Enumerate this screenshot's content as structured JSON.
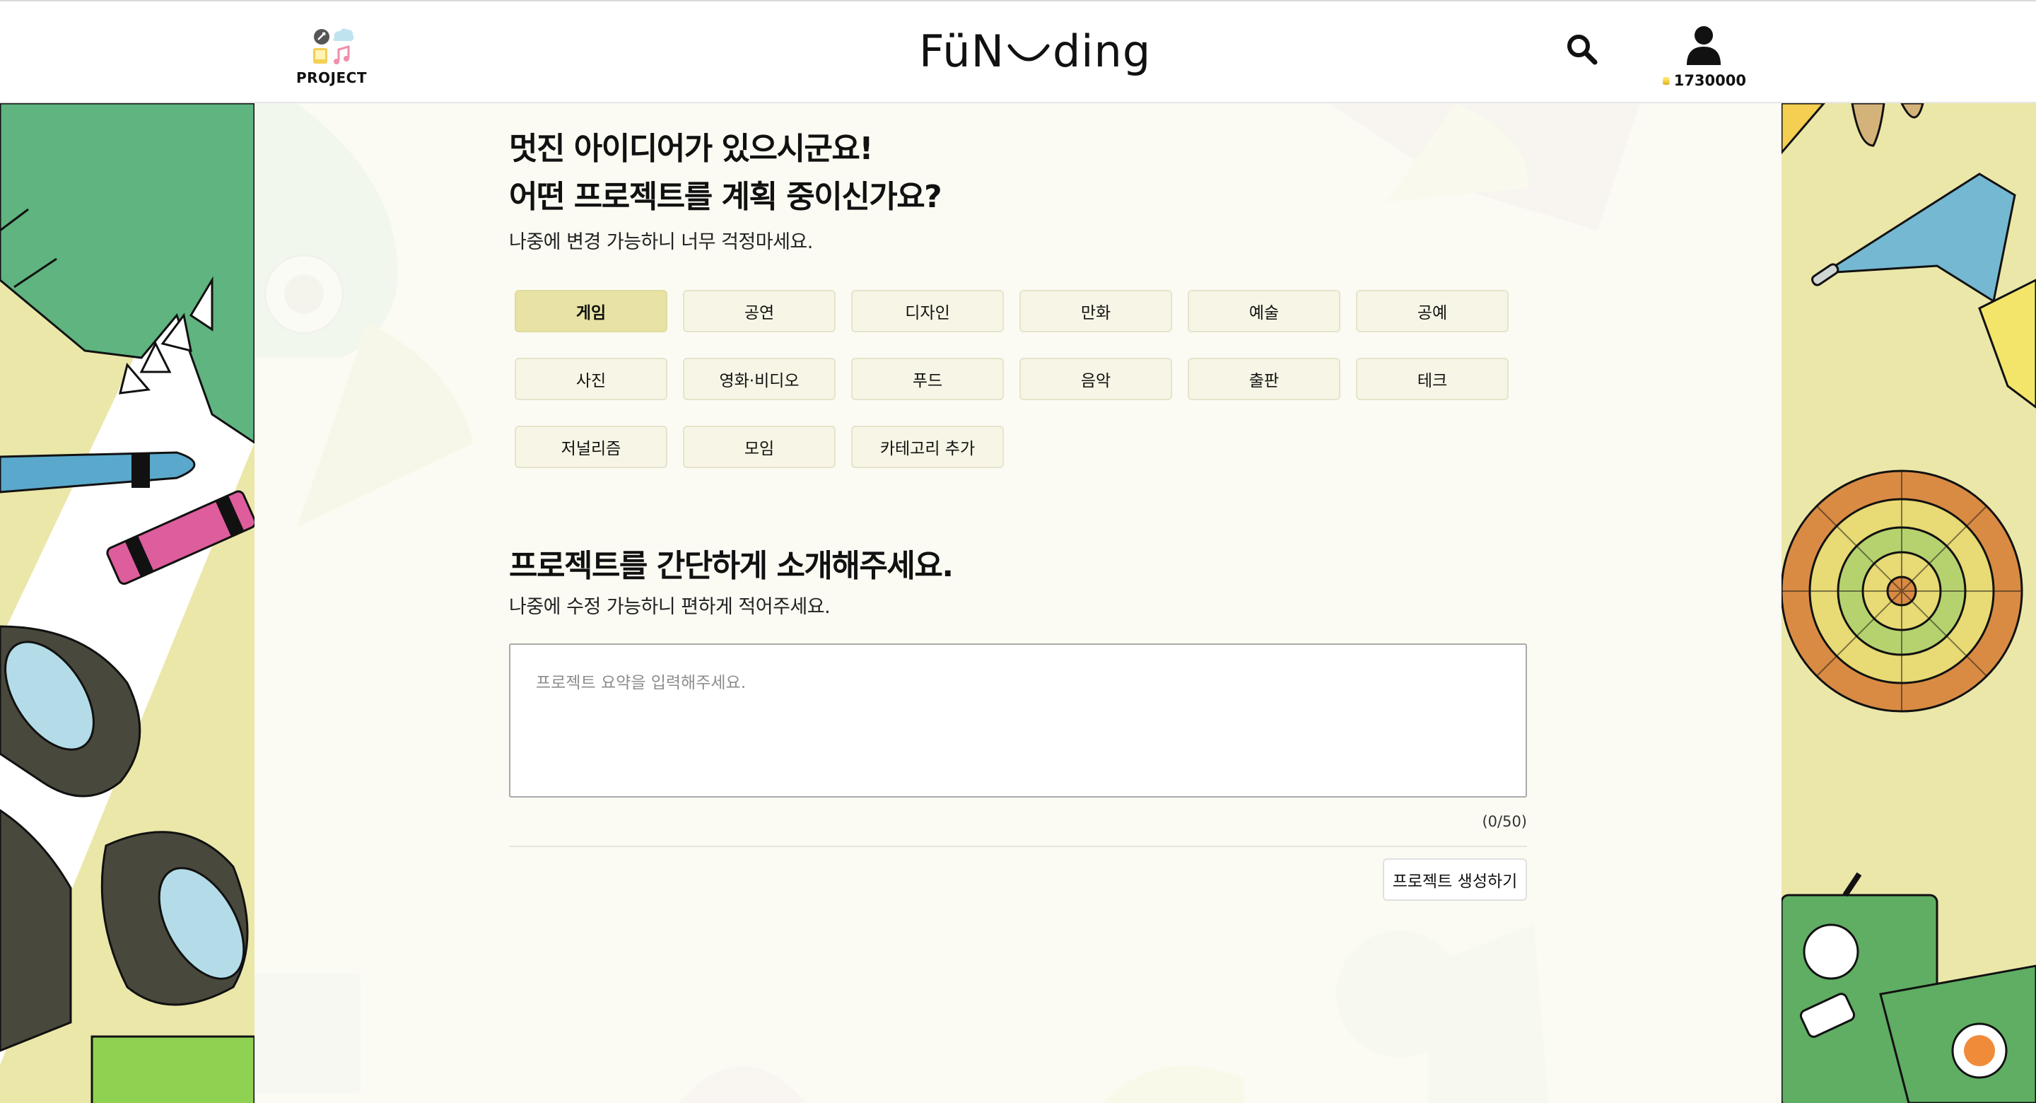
{
  "header": {
    "project_label": "PROJECT",
    "logo_left": "FüN",
    "logo_right": "ding",
    "coins": "1730000"
  },
  "category_section": {
    "title_line1": "멋진 아이디어가 있으시군요!",
    "title_line2": "어떤 프로젝트를 계획 중이신가요?",
    "subtitle": "나중에 변경 가능하니 너무 걱정마세요.",
    "selected": "게임",
    "categories": [
      "게임",
      "공연",
      "디자인",
      "만화",
      "예술",
      "공예",
      "사진",
      "영화·비디오",
      "푸드",
      "음악",
      "출판",
      "테크",
      "저널리즘",
      "모임",
      "카테고리 추가"
    ]
  },
  "intro_section": {
    "title": "프로젝트를 간단하게 소개해주세요.",
    "subtitle": "나중에 수정 가능하니 편하게 적어주세요.",
    "placeholder": "프로젝트 요약을 입력해주세요.",
    "value": "",
    "counter": "(0/50)",
    "submit_label": "프로젝트 생성하기"
  },
  "colors": {
    "accent": "#e8e3a4",
    "panel": "#fbfbf3",
    "side": "#ebe7a9",
    "green": "#5fb47f",
    "orange": "#d98b44"
  }
}
